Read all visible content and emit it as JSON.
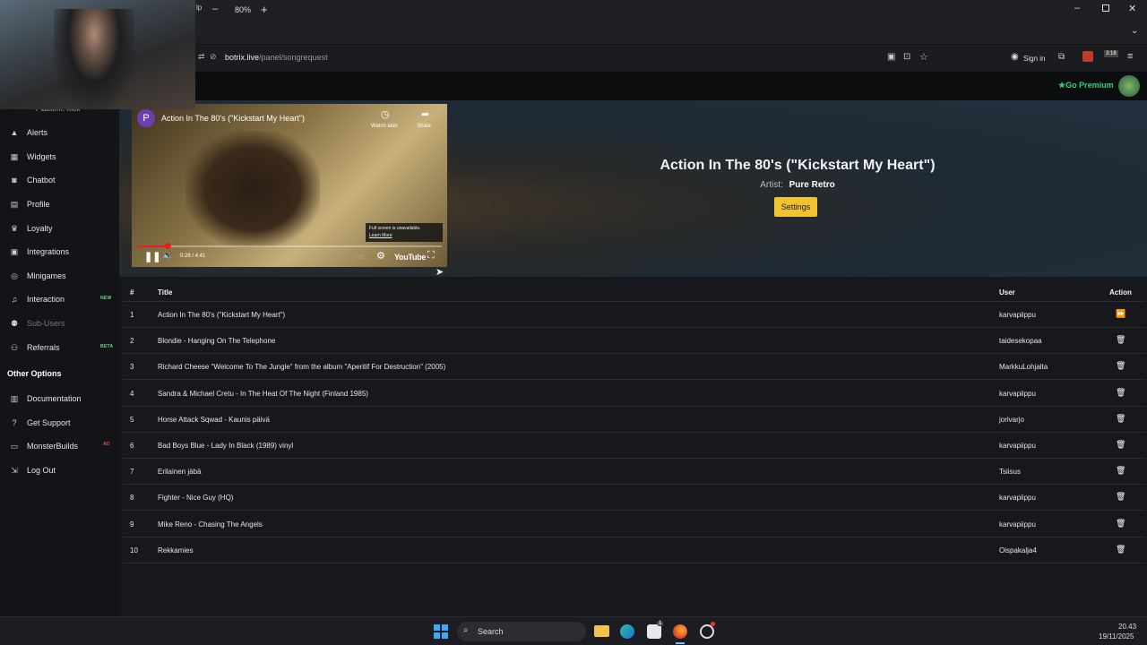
{
  "browser": {
    "zoom": "80%",
    "menu_fragment": "lp",
    "url_domain": "botrix.live",
    "url_path": "/panel/songrequest",
    "sign_in": "Sign in",
    "ext_badge": "3:18"
  },
  "topnav": {
    "premium": "Go Premium"
  },
  "sidebar": {
    "platform_fragment": "Platform: Kick",
    "items": [
      {
        "label": "Alerts",
        "icon": "bell-icon"
      },
      {
        "label": "Widgets",
        "icon": "grid-icon"
      },
      {
        "label": "Chatbot",
        "icon": "robot-icon"
      },
      {
        "label": "Profile",
        "icon": "id-card-icon"
      },
      {
        "label": "Loyalty",
        "icon": "trophy-icon"
      },
      {
        "label": "Integrations",
        "icon": "plug-icon"
      },
      {
        "label": "Minigames",
        "icon": "gamepad-icon"
      },
      {
        "label": "Interaction",
        "icon": "music-icon",
        "badge": "NEW"
      },
      {
        "label": "Sub-Users",
        "icon": "users-icon"
      },
      {
        "label": "Referrals",
        "icon": "user-group-icon",
        "badge": "BETA"
      }
    ],
    "other_heading": "Other Options",
    "other_items": [
      {
        "label": "Documentation",
        "icon": "book-icon"
      },
      {
        "label": "Get Support",
        "icon": "question-icon"
      },
      {
        "label": "MonsterBuilds",
        "icon": "desktop-icon",
        "badge": "AD"
      },
      {
        "label": "Log Out",
        "icon": "logout-icon"
      }
    ]
  },
  "player": {
    "channel_initial": "P",
    "title": "Action In The 80's (\"Kickstart My Heart\")",
    "watch_later": "Watch later",
    "share": "Share",
    "fullscreen_notice": "Full screen is unavailable.",
    "learn_more": "Learn More",
    "time": "0:28 / 4:41",
    "progress": 0.1,
    "brand": "YouTube"
  },
  "now_playing": {
    "title": "Action In The 80's (\"Kickstart My Heart\")",
    "artist_label": "Artist:",
    "artist": "Pure Retro",
    "settings": "Settings"
  },
  "table": {
    "headers": {
      "num": "#",
      "title": "Title",
      "user": "User",
      "action": "Action"
    },
    "rows": [
      {
        "num": "1",
        "title": "Action In The 80's (\"Kickstart My Heart\")",
        "user": "karvapiippu",
        "action": "skip"
      },
      {
        "num": "2",
        "title": "Blondie - Hanging On The Telephone",
        "user": "taidesekopaa",
        "action": "delete"
      },
      {
        "num": "3",
        "title": "Richard Cheese \"Welcome To The Jungle\" from the album \"Aperitif For Destruction\" (2005)",
        "user": "MarkkuLohjalta",
        "action": "delete"
      },
      {
        "num": "4",
        "title": "Sandra & Michael Cretu - In The Heat Of The Night (Finland 1985)",
        "user": "karvapiippu",
        "action": "delete"
      },
      {
        "num": "5",
        "title": "Horse Attack Sqwad - Kaunis päivä",
        "user": "jorivarjo",
        "action": "delete"
      },
      {
        "num": "6",
        "title": "Bad Boys Blue - Lady In Black (1989) vinyl",
        "user": "karvapiippu",
        "action": "delete"
      },
      {
        "num": "7",
        "title": "Erilainen jäbä",
        "user": "Tsiisus",
        "action": "delete"
      },
      {
        "num": "8",
        "title": "Fighter - Nice Guy (HQ)",
        "user": "karvapiippu",
        "action": "delete"
      },
      {
        "num": "9",
        "title": "Mike Reno - Chasing The Angels",
        "user": "karvapiippu",
        "action": "delete"
      },
      {
        "num": "10",
        "title": "Rekkamies",
        "user": "Oispakalja4",
        "action": "delete"
      }
    ]
  },
  "taskbar": {
    "search": "Search",
    "time": "20.43",
    "date": "19/11/2025",
    "store_badge": "1"
  },
  "colors": {
    "accent": "#f1c232",
    "premium": "#2ed47a",
    "badge_new": "#6ed28b"
  }
}
